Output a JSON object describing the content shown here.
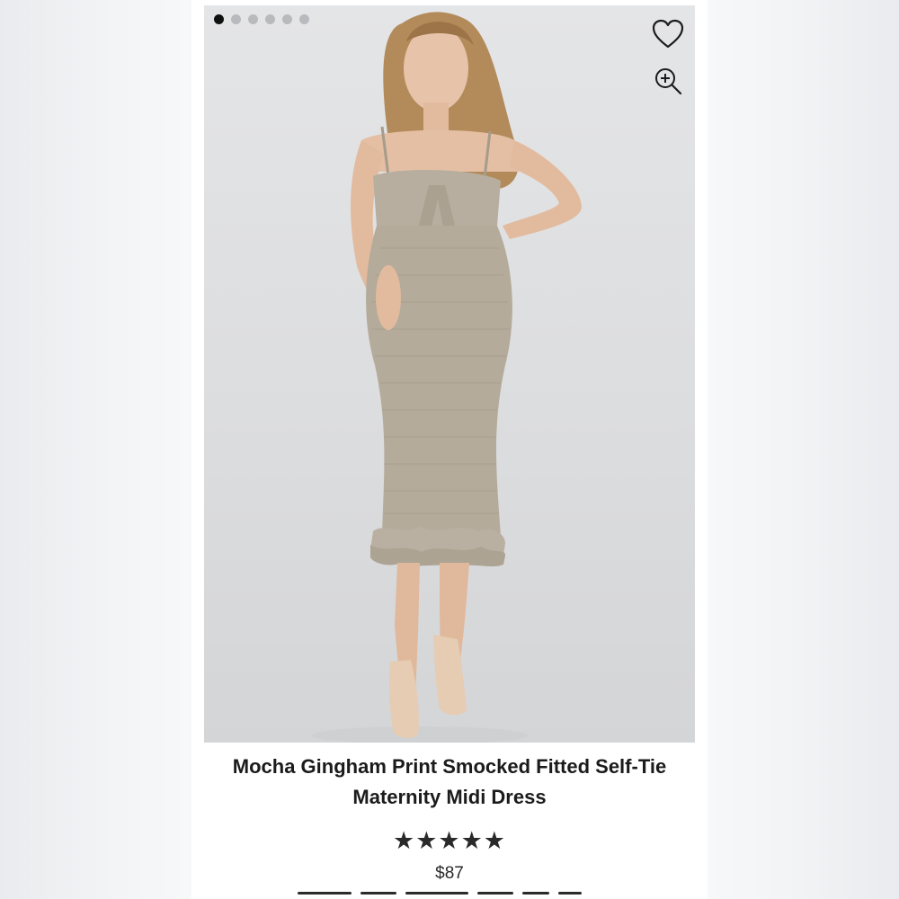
{
  "gallery": {
    "image_count": 6,
    "active_index": 0,
    "favorite_icon": "heart-icon",
    "zoom_icon": "zoom-in-icon"
  },
  "product": {
    "title_line1": "Mocha Gingham Print Smocked Fitted Self-Tie",
    "title_line2": "Maternity Midi Dress",
    "rating_stars": "★★★★★",
    "rating_value": 5,
    "price": "$87"
  },
  "colors": {
    "text": "#1b1b1b",
    "active_dot": "#111111",
    "inactive_dot": "#b9babd",
    "dress": "#b4ab9b"
  }
}
